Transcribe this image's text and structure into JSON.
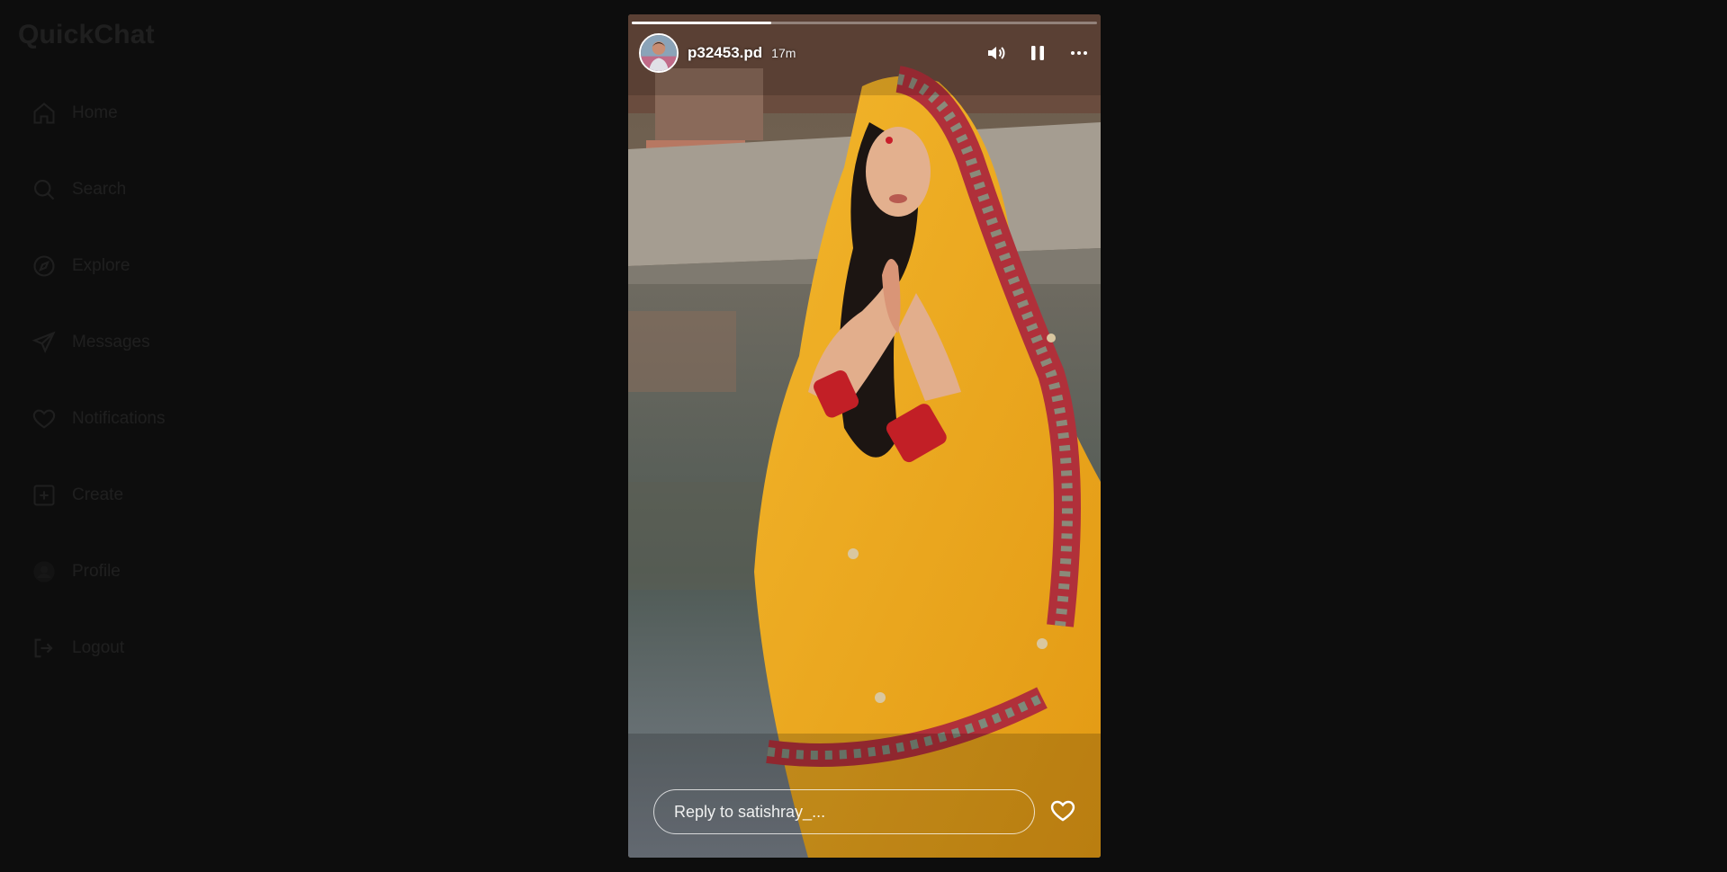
{
  "app": {
    "brand": "QuickChat"
  },
  "sidebar": {
    "items": [
      {
        "label": "Home",
        "icon": "home-icon"
      },
      {
        "label": "Search",
        "icon": "search-icon"
      },
      {
        "label": "Explore",
        "icon": "compass-icon"
      },
      {
        "label": "Messages",
        "icon": "send-icon"
      },
      {
        "label": "Notifications",
        "icon": "heart-icon"
      },
      {
        "label": "Create",
        "icon": "plus-square-icon"
      },
      {
        "label": "Profile",
        "icon": "avatar-icon"
      },
      {
        "label": "Logout",
        "icon": "logout-icon"
      }
    ]
  },
  "story": {
    "username": "p32453.pd",
    "time": "17m",
    "progress": 0.3,
    "controls": {
      "volume_icon": "volume-icon",
      "pause_icon": "pause-icon",
      "more_icon": "more-icon"
    },
    "reply": {
      "placeholder": "Reply to satishray_..."
    },
    "like_icon": "heart-icon",
    "colors": {
      "saree": "#f0b020",
      "border": "#b0303a",
      "water": "#5d6660"
    }
  }
}
